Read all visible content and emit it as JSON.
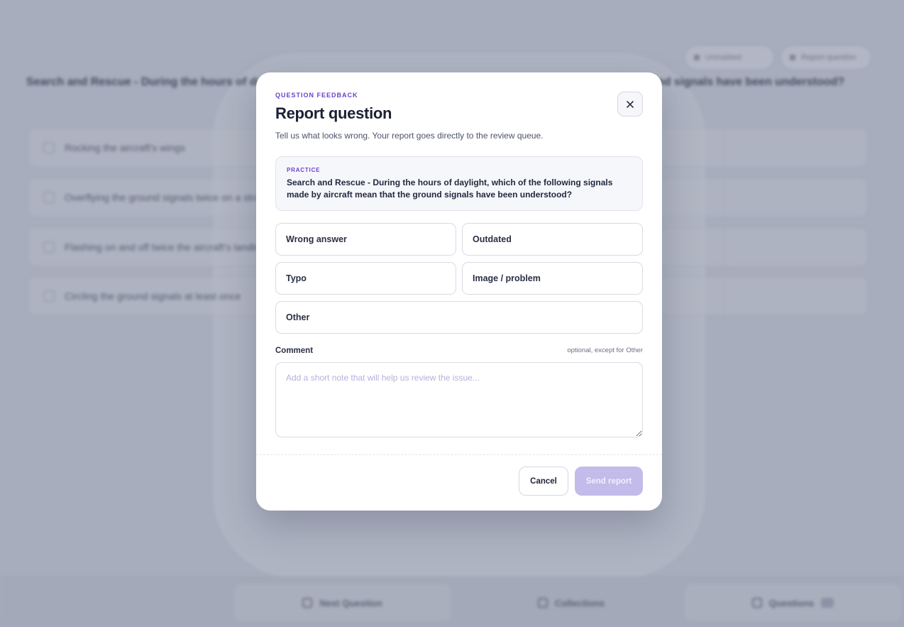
{
  "background": {
    "question_text": "Search and Rescue - During the hours of daylight, which of the following signals made by aircraft mean that the ground signals have been understood?",
    "options": [
      "Rocking the aircraft's wings",
      "Overflying the ground signals twice on a straight line",
      "Flashing on and off twice the aircraft's landing lights",
      "Circling the ground signals at least once"
    ],
    "top_pills": [
      "Unmarked",
      "Report question"
    ],
    "bottom_nav": [
      "Next Question",
      "Collections",
      "Questions"
    ]
  },
  "modal": {
    "eyebrow": "QUESTION FEEDBACK",
    "title": "Report question",
    "subtitle": "Tell us what looks wrong. Your report goes directly to the review queue.",
    "question_mode": "PRACTICE",
    "question_text": "Search and Rescue - During the hours of daylight, which of the following signals made by aircraft mean that the ground signals have been understood?",
    "reasons": [
      "Wrong answer",
      "Outdated",
      "Typo",
      "Image / problem",
      "Other"
    ],
    "comment_label": "Comment",
    "comment_hint": "optional, except for Other",
    "comment_placeholder": "Add a short note that will help us review the issue...",
    "cancel_label": "Cancel",
    "send_label": "Send report",
    "close_icon": "close-icon"
  },
  "colors": {
    "accent": "#6b3fd1",
    "send_disabled": "#c3bbea",
    "overlay": "#a7adbc"
  }
}
